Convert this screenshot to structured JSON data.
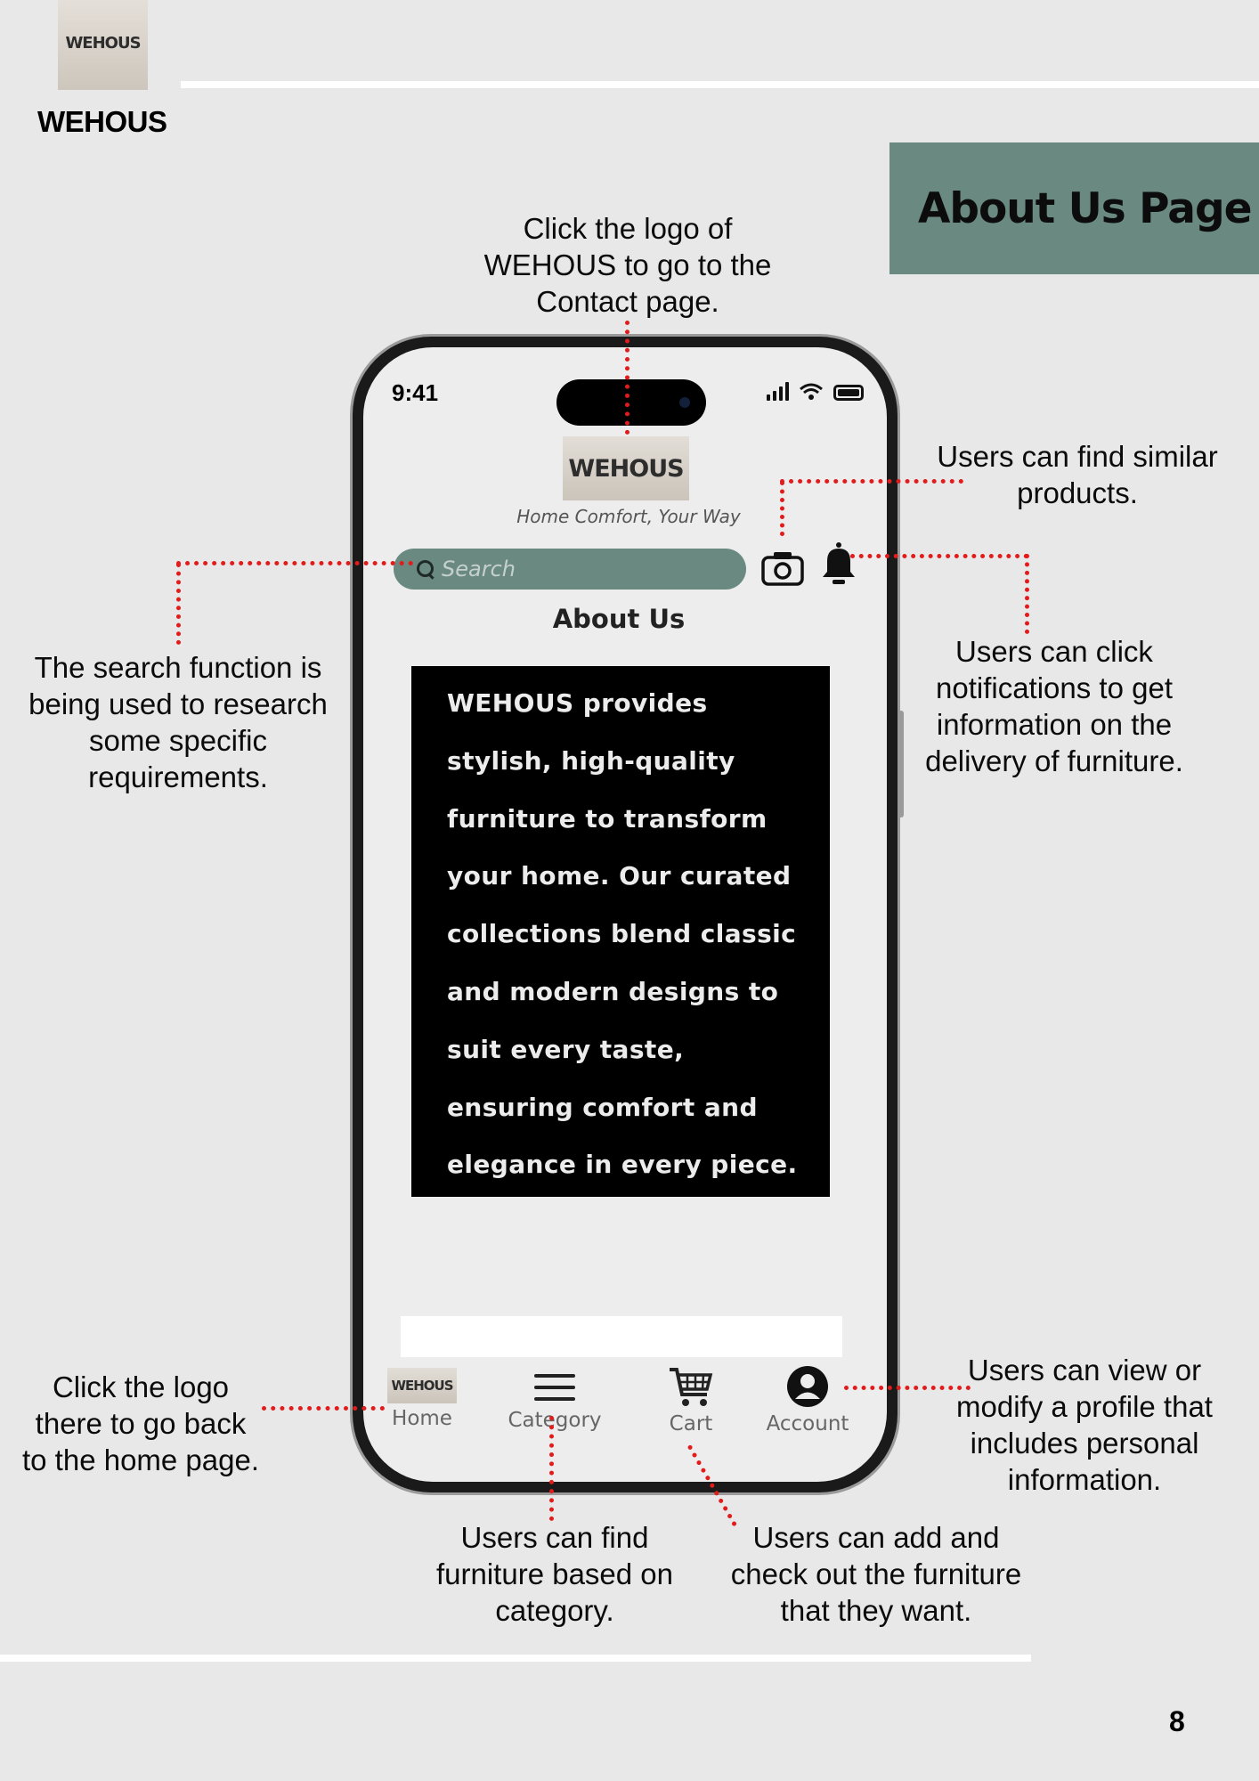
{
  "header": {
    "brand_logo_text": "WEHOUS",
    "brand_name": "WEHOUS",
    "page_title": "About Us Page"
  },
  "phone": {
    "status_time": "9:41",
    "app_logo_text": "WEHOUS",
    "tagline": "Home Comfort, Your Way",
    "search_placeholder": "Search",
    "about_title": "About Us",
    "about_text": "WEHOUS provides\nstylish, high-quality\nfurniture to transform\nyour home. Our curated\ncollections blend classic\nand modern designs to\nsuit every taste,\nensuring comfort and\nelegance in every piece.",
    "nav": [
      {
        "label": "Home",
        "icon": "home-logo-icon"
      },
      {
        "label": "Category",
        "icon": "hamburger-icon"
      },
      {
        "label": "Cart",
        "icon": "cart-icon"
      },
      {
        "label": "Account",
        "icon": "account-icon"
      }
    ]
  },
  "annotations": {
    "logo_contact": "Click the logo of\nWEHOUS to go to the\nContact page.",
    "similar_products": "Users can find similar\nproducts.",
    "notifications": "Users can click\nnotifications to get\ninformation on the\ndelivery of furniture.",
    "search": "The search function is\nbeing used to research\nsome specific\nrequirements.",
    "home_logo": "Click the logo\nthere to go back\nto the home page.",
    "profile": "Users can view or\nmodify a profile that\nincludes personal\ninformation.",
    "category": "Users can find\nfurniture based on\ncategory.",
    "cart": "Users can add and\ncheck out the furniture\nthat they want."
  },
  "page_number": "8",
  "colors": {
    "background": "#e8e8e8",
    "accent_green": "#6a8a81",
    "connector_red": "#e21b1b"
  }
}
